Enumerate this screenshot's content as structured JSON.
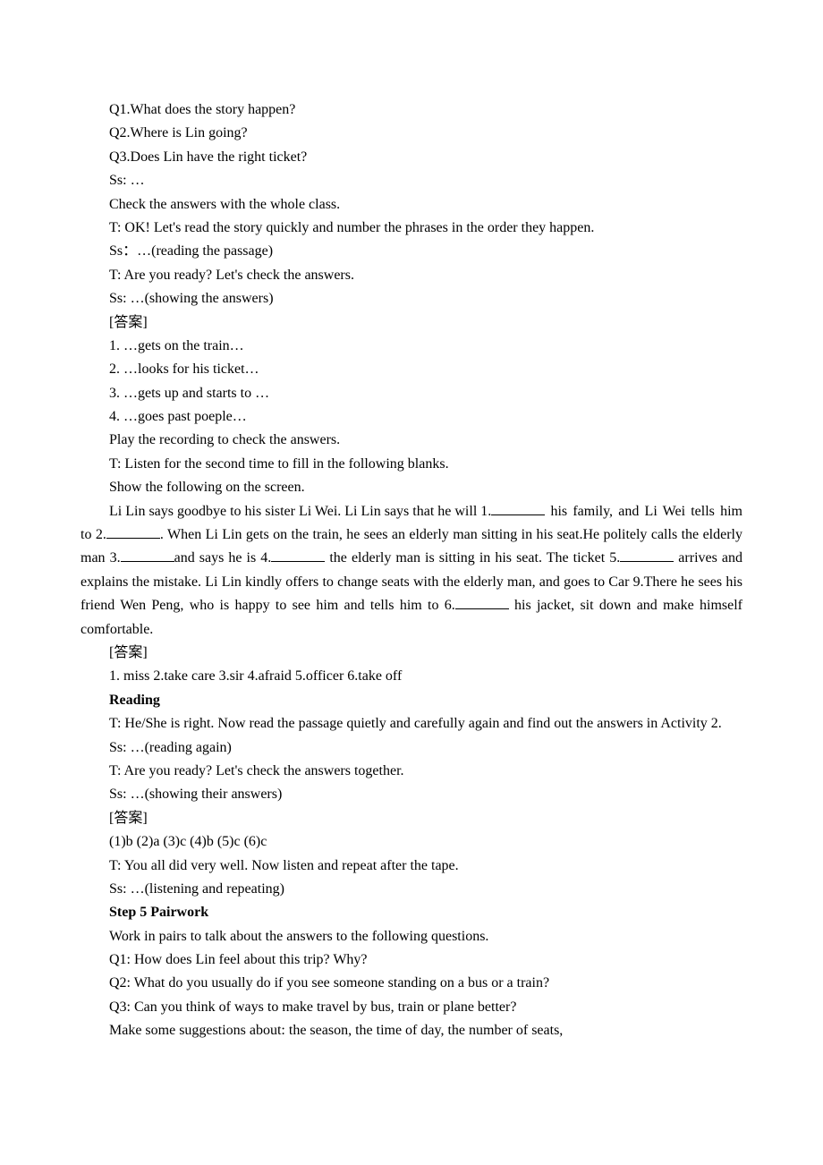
{
  "lines": {
    "q1": "Q1.What does the story happen?",
    "q2": "Q2.Where is Lin going?",
    "q3": "Q3.Does Lin have the right ticket?",
    "ss1": "Ss: …",
    "check1": "Check the answers with the whole class.",
    "t1": "T: OK! Let's read the story quickly and number the phrases in the order they happen.",
    "ss2": "Ss：…(reading the passage)",
    "t2": "T: Are you ready? Let's check the answers.",
    "ss3": "Ss: …(showing the answers)",
    "ans_label1": "[答案]",
    "a1": "1. …gets on the train…",
    "a2": "2. …looks for his ticket…",
    "a3": "3. …gets up and starts to …",
    "a4": "4. …goes past poeple…",
    "play": "Play the recording to check the answers.",
    "t3": "T: Listen for the second time to fill in the following blanks.",
    "show": "Show the following on the screen.",
    "cloze": {
      "s1a": "Li Lin says goodbye to his sister Li Wei. Li Lin says that he will 1.",
      "s1b": " his family, and Li Wei tells him to 2.",
      "s1c": ". When Li Lin gets on the train, he sees an elderly man sitting in his seat.He politely calls the elderly man 3.",
      "s1d": "and says he is 4.",
      "s1e": " the elderly man is sitting in his seat. The ticket 5.",
      "s1f": " arrives and explains the mistake. Li Lin kindly offers to change seats with the elderly man, and goes to Car 9.There he sees his friend Wen Peng, who is happy to see him and tells him to 6.",
      "s1g": " his jacket, sit down and make himself comfortable."
    },
    "ans_label2": "[答案]",
    "ans2": "1. miss  2.take care  3.sir  4.afraid  5.officer  6.take off",
    "reading": "Reading",
    "t4": "T: He/She is right. Now read the passage quietly and carefully again and find out the answers in Activity 2.",
    "ss4": "Ss: …(reading again)",
    "t5": "T: Are you ready? Let's check the answers together.",
    "ss5": "Ss: …(showing their answers)",
    "ans_label3": "[答案]",
    "ans3": "(1)b  (2)a  (3)c  (4)b  (5)c  (6)c",
    "t6": "T: You all did very well. Now listen and repeat after the tape.",
    "ss6": "Ss: …(listening and repeating)",
    "step5": "Step 5  Pairwork",
    "pair1": "Work in pairs to talk about the answers to the following questions.",
    "pq1": "Q1: How does Lin feel about this trip? Why?",
    "pq2": "Q2: What do you usually do if you see someone standing on a bus or a train?",
    "pq3": "Q3: Can you think of ways to make travel by bus, train or plane better?",
    "make": "Make some suggestions about: the season, the time of day, the number of seats,"
  }
}
